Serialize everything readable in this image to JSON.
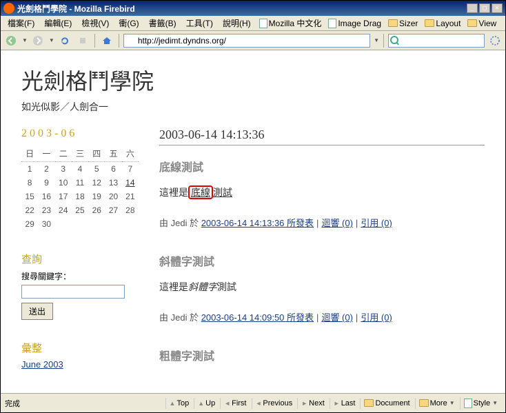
{
  "window": {
    "title": "光劍格鬥學院 - Mozilla Firebird"
  },
  "menubar": {
    "file": "檔案(F)",
    "edit": "編輯(E)",
    "view": "檢視(V)",
    "go": "衝(G)",
    "bookmarks": "書籤(B)",
    "tools": "工具(T)",
    "help": "說明(H)",
    "link1": "Mozilla 中文化",
    "link2": "Image Drag",
    "link3": "Sizer",
    "link4": "Layout",
    "link5": "View"
  },
  "toolbar": {
    "url": "http://jedimt.dyndns.org/"
  },
  "site": {
    "title": "光劍格鬥學院",
    "subtitle": "如光似影／人劍合一"
  },
  "calendar": {
    "title": "2003-06",
    "dow": [
      "日",
      "一",
      "二",
      "三",
      "四",
      "五",
      "六"
    ],
    "rows": [
      [
        "1",
        "2",
        "3",
        "4",
        "5",
        "6",
        "7"
      ],
      [
        "8",
        "9",
        "10",
        "11",
        "12",
        "13",
        "14"
      ],
      [
        "15",
        "16",
        "17",
        "18",
        "19",
        "20",
        "21"
      ],
      [
        "22",
        "23",
        "24",
        "25",
        "26",
        "27",
        "28"
      ],
      [
        "29",
        "30",
        "",
        "",
        "",
        "",
        ""
      ]
    ],
    "today": "14"
  },
  "sidebar": {
    "search_head": "查詢",
    "search_label": "搜尋關鍵字：",
    "submit": "送出",
    "archive_head": "彙整",
    "archive_link": "June 2003"
  },
  "posts": {
    "date_header": "2003-06-14 14:13:36",
    "p1": {
      "title": "底線測試",
      "body_prefix": "這裡是",
      "body_boxed": "底線",
      "body_suffix": "測試",
      "author_prefix": "由 Jedi 於 ",
      "posted": "2003-06-14 14:13:36 所發表",
      "comments": "迴響 (0)",
      "trackback": "引用 (0)"
    },
    "p2": {
      "title": "斜體字測試",
      "body_prefix": "這裡是",
      "body_italic": "斜體字",
      "body_suffix": "測試",
      "author_prefix": "由 Jedi 於 ",
      "posted": "2003-06-14 14:09:50 所發表",
      "comments": "迴響 (0)",
      "trackback": "引用 (0)"
    },
    "p3": {
      "title": "粗體字測試"
    }
  },
  "statusbar": {
    "done": "完成",
    "top": "Top",
    "up": "Up",
    "first": "First",
    "previous": "Previous",
    "next": "Next",
    "last": "Last",
    "document": "Document",
    "more": "More",
    "style": "Style"
  }
}
